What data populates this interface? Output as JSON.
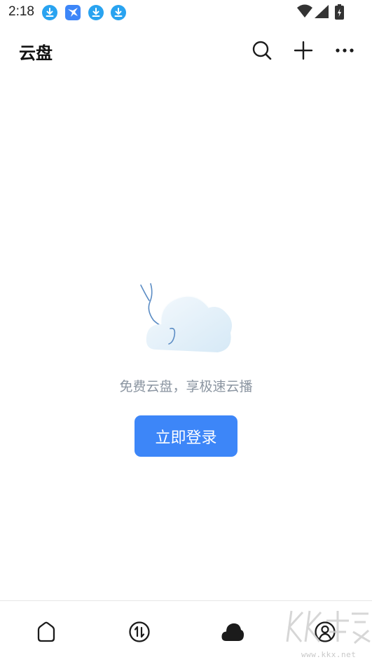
{
  "status_bar": {
    "time": "2:18",
    "notifications": [
      "download-icon",
      "bird-app-icon",
      "download-icon",
      "download-icon"
    ],
    "system": [
      "wifi-icon",
      "signal-icon",
      "battery-icon"
    ]
  },
  "header": {
    "title": "云盘",
    "actions": [
      "search-icon",
      "plus-icon",
      "more-icon"
    ]
  },
  "empty_state": {
    "illustration": "cloud-illustration",
    "message": "免费云盘，享极速云播",
    "button_label": "立即登录"
  },
  "bottom_nav": {
    "items": [
      {
        "icon": "home-icon",
        "active": false
      },
      {
        "icon": "transfer-icon",
        "active": false
      },
      {
        "icon": "cloud-icon",
        "active": true
      },
      {
        "icon": "profile-icon",
        "active": false
      }
    ]
  },
  "watermark": {
    "text": "www.kkx.net"
  },
  "colors": {
    "accent": "#3d86f8",
    "notification_blue": "#29a3f0",
    "muted_text": "#8b95a1"
  }
}
